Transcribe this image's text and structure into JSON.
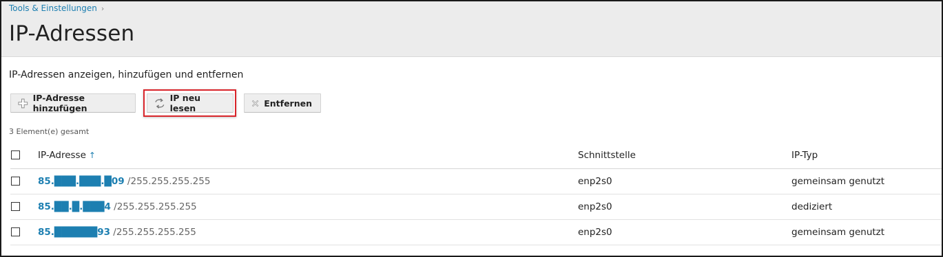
{
  "breadcrumb": {
    "label": "Tools & Einstellungen",
    "separator": "›"
  },
  "page": {
    "title": "IP-Adressen",
    "description": "IP-Adressen anzeigen, hinzufügen und entfernen"
  },
  "toolbar": {
    "add_label": "IP-Adresse hinzufügen",
    "reread_label": "IP neu lesen",
    "remove_label": "Entfernen",
    "highlight_color": "#d9252b"
  },
  "list": {
    "count_text": "3 Element(e) gesamt",
    "columns": {
      "ip": "IP-Adresse",
      "sort_indicator": "↑",
      "interface": "Schnittstelle",
      "type": "IP-Typ"
    },
    "rows": [
      {
        "ip": "85.███.███.█09",
        "mask": " /255.255.255.255",
        "interface": "enp2s0",
        "type": "gemeinsam genutzt"
      },
      {
        "ip": "85.██.█.███4",
        "mask": " /255.255.255.255",
        "interface": "enp2s0",
        "type": "dediziert"
      },
      {
        "ip": "85.██████93",
        "mask": " /255.255.255.255",
        "interface": "enp2s0",
        "type": "gemeinsam genutzt"
      }
    ]
  },
  "colors": {
    "accent": "#1d7fb1",
    "header_bg": "#ececec"
  }
}
